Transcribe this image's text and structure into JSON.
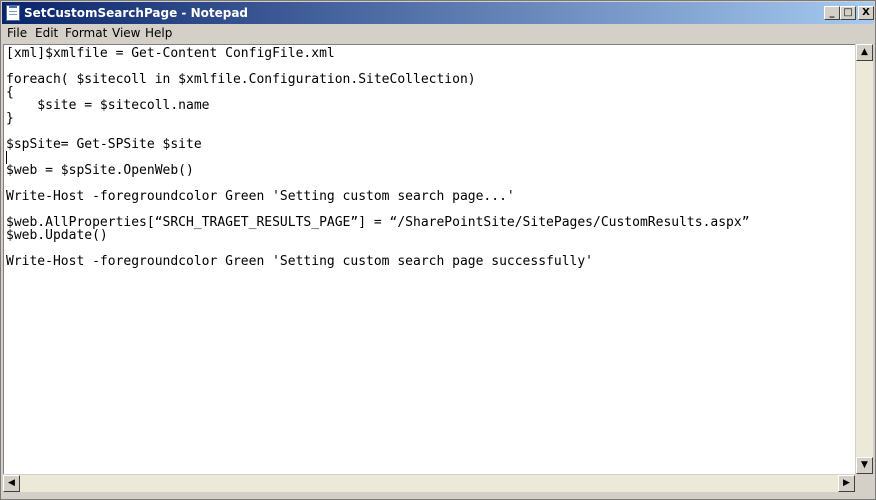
{
  "window": {
    "title": "SetCustomSearchPage - Notepad"
  },
  "title_buttons": {
    "minimize": "_",
    "maximize": "□",
    "close": "X"
  },
  "menu": [
    "File",
    "Edit",
    "Format",
    "View",
    "Help"
  ],
  "lines": [
    "[xml]$xmlfile = Get-Content ConfigFile.xml",
    "foreach( $sitecoll in $xmlfile.Configuration.SiteCollection)",
    "{",
    "    $site = $sitecoll.name",
    "}",
    "$spSite= Get-SPSite $site",
    "$web = $spSite.OpenWeb()",
    "Write-Host -foregroundcolor Green 'Setting custom search page...'",
    "$web.AllProperties[“SRCH_TRAGET_RESULTS_PAGE”] = “/SharePointSite/SitePages/CustomResults.aspx”",
    "$web.Update()",
    "Write-Host -foregroundcolor Green 'Setting custom search page successfully'"
  ],
  "scroll_glyphs": {
    "up": "▲",
    "down": "▼",
    "left": "◀",
    "right": "▶"
  }
}
